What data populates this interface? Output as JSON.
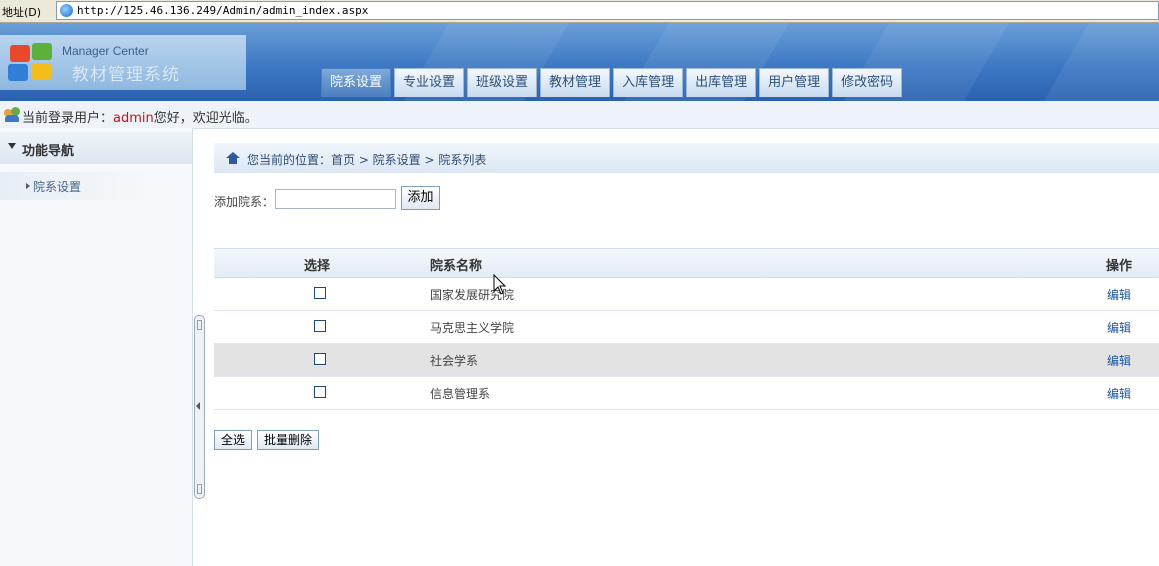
{
  "address_bar": {
    "label": "地址(D)",
    "url": "http://125.46.136.249/Admin/admin_index.aspx"
  },
  "header": {
    "logo_en": "Manager Center",
    "logo_cn": "教材管理系统",
    "tabs": [
      {
        "label": "院系设置",
        "active": true
      },
      {
        "label": "专业设置",
        "active": false
      },
      {
        "label": "班级设置",
        "active": false
      },
      {
        "label": "教材管理",
        "active": false
      },
      {
        "label": "入库管理",
        "active": false
      },
      {
        "label": "出库管理",
        "active": false
      },
      {
        "label": "用户管理",
        "active": false
      },
      {
        "label": "修改密码",
        "active": false
      }
    ]
  },
  "user_bar": {
    "prefix": "当前登录用户：",
    "username": "admin",
    "suffix": "您好，欢迎光临。"
  },
  "sidebar": {
    "heading": "功能导航",
    "items": [
      {
        "label": "院系设置"
      }
    ]
  },
  "breadcrumb": "您当前的位置：首页 > 院系设置 > 院系列表",
  "add_form": {
    "label": "添加院系：",
    "input_value": "",
    "button": "添加"
  },
  "table": {
    "headers": {
      "select": "选择",
      "name": "院系名称",
      "action": "操作"
    },
    "rows": [
      {
        "name": "国家发展研究院",
        "action": "编辑",
        "checked": false
      },
      {
        "name": "马克思主义学院",
        "action": "编辑",
        "checked": false
      },
      {
        "name": "社会学系",
        "action": "编辑",
        "checked": false
      },
      {
        "name": "信息管理系",
        "action": "编辑",
        "checked": false
      }
    ]
  },
  "actions": {
    "select_all": "全选",
    "batch_delete": "批量删除"
  },
  "colors": {
    "header_blue": "#3d78c4",
    "active_tab": "#4b7fc0",
    "link_blue": "#1b56a8",
    "username_red": "#cc1111",
    "highlight_row": "#e3e3e3"
  },
  "icons": [
    "ie-globe-icon",
    "windows-logo-icon",
    "users-icon",
    "triangle-down-icon",
    "arrow-right-icon",
    "home-icon",
    "mouse-cursor-icon"
  ]
}
